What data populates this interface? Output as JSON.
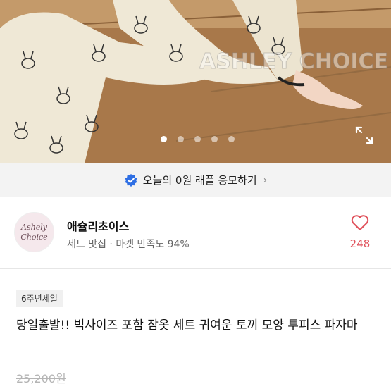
{
  "hero": {
    "watermark": "ASHLEY CHOICE",
    "carousel_total": 5,
    "carousel_active": 1,
    "expand_icon": "expand-icon"
  },
  "raffle": {
    "icon": "verified-check-icon",
    "text": "오늘의 0원 래플 응모하기",
    "chevron": "›"
  },
  "seller": {
    "avatar_line1": "Ashely",
    "avatar_line2": "Choice",
    "name": "애슐리초이스",
    "subtitle": "세트 맛집 · 마켓 만족도 94%",
    "like_icon": "heart-outline-icon",
    "like_count": "248"
  },
  "product": {
    "badge": "6주년세일",
    "title": "당일출발!! 빅사이즈 포함 잠옷 세트 귀여운 토끼 모양 투피스 파자마",
    "original_price": "25,200원"
  },
  "colors": {
    "accent": "#e0505a",
    "verified": "#2f6fe4",
    "banner_bg": "#f3f3f3"
  }
}
